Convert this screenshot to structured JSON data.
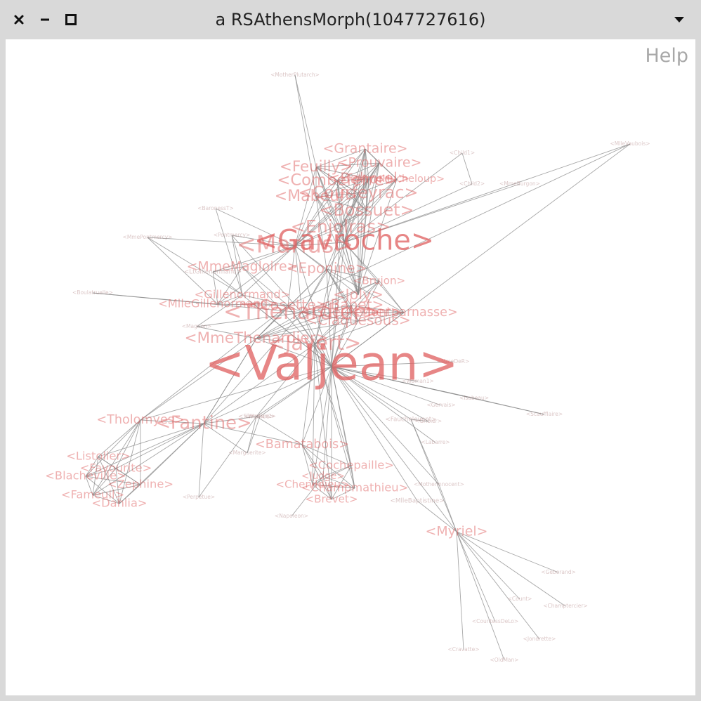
{
  "window": {
    "title": "a RSAthensMorph(1047727616)",
    "close_icon": "close-icon",
    "minimize_icon": "minimize-icon",
    "maximize_icon": "maximize-icon",
    "menu_icon": "dropdown-triangle-icon"
  },
  "canvas": {
    "help_label": "Help",
    "edge_color": "#8a8a8a",
    "label_color": "#e06464"
  },
  "graph": {
    "nodes": [
      {
        "id": "valjean",
        "label": "<Valjean>",
        "weight": 1.0
      },
      {
        "id": "gavroche",
        "label": "<Gavroche>",
        "weight": 0.55
      },
      {
        "id": "marius",
        "label": "<Marius>",
        "weight": 0.45
      },
      {
        "id": "javert",
        "label": "<Javert>",
        "weight": 0.38
      },
      {
        "id": "thenardier",
        "label": "<Thenardier>",
        "weight": 0.42
      },
      {
        "id": "fantine",
        "label": "<Fantine>",
        "weight": 0.33
      },
      {
        "id": "enjolras",
        "label": "<Enjolras>",
        "weight": 0.32
      },
      {
        "id": "courfeyrac",
        "label": "<Courfeyrac>",
        "weight": 0.3
      },
      {
        "id": "bossuet",
        "label": "<Bossuet>",
        "weight": 0.3
      },
      {
        "id": "combeferre",
        "label": "<Combeferre>",
        "weight": 0.28
      },
      {
        "id": "mabeuf",
        "label": "<Mabeuf>",
        "weight": 0.27
      },
      {
        "id": "feuilly",
        "label": "<Feuilly>",
        "weight": 0.26
      },
      {
        "id": "bahorel",
        "label": "<Bahorel>",
        "weight": 0.26
      },
      {
        "id": "joly",
        "label": "<Joly>",
        "weight": 0.25
      },
      {
        "id": "grantaire",
        "label": "<Grantaire>",
        "weight": 0.22
      },
      {
        "id": "prouvaire",
        "label": "<Prouvaire>",
        "weight": 0.22
      },
      {
        "id": "eponine",
        "label": "<Eponine>",
        "weight": 0.24
      },
      {
        "id": "mmethenardier",
        "label": "<MmeThenardier>",
        "weight": 0.26
      },
      {
        "id": "babet",
        "label": "<Babet>",
        "weight": 0.24
      },
      {
        "id": "gueulemer",
        "label": "<Gueulemer>",
        "weight": 0.24
      },
      {
        "id": "claquesous",
        "label": "<Claquesous>",
        "weight": 0.24
      },
      {
        "id": "montparnasse",
        "label": "<Montparnasse>",
        "weight": 0.2
      },
      {
        "id": "brujon",
        "label": "<Brujon>",
        "weight": 0.16
      },
      {
        "id": "cosette",
        "label": "<Cosette>",
        "weight": 0.25
      },
      {
        "id": "mmemagloire",
        "label": "<MmeMagloire>",
        "weight": 0.22
      },
      {
        "id": "gillenormand",
        "label": "<Gillenormand>",
        "weight": 0.18
      },
      {
        "id": "mllegillenormand",
        "label": "<MlleGillenormand>",
        "weight": 0.18
      },
      {
        "id": "tholomyes",
        "label": "<Tholomyes>",
        "weight": 0.2
      },
      {
        "id": "listolier",
        "label": "<Listolier>",
        "weight": 0.18
      },
      {
        "id": "fameuil",
        "label": "<Fameuil>",
        "weight": 0.18
      },
      {
        "id": "blacheville",
        "label": "<Blacheville>",
        "weight": 0.18
      },
      {
        "id": "favourite",
        "label": "<Favourite>",
        "weight": 0.18
      },
      {
        "id": "zephine",
        "label": "<Zephine>",
        "weight": 0.18
      },
      {
        "id": "dahlia",
        "label": "<Dahlia>",
        "weight": 0.18
      },
      {
        "id": "bamatabois",
        "label": "<Bamatabois>",
        "weight": 0.2
      },
      {
        "id": "champmathieu",
        "label": "<Champmathieu>",
        "weight": 0.18
      },
      {
        "id": "chenildieu",
        "label": "<Chenildieu>",
        "weight": 0.16
      },
      {
        "id": "cochepaille",
        "label": "<Cochepaille>",
        "weight": 0.18
      },
      {
        "id": "brevet",
        "label": "<Brevet>",
        "weight": 0.16
      },
      {
        "id": "judge",
        "label": "<Judge>",
        "weight": 0.14
      },
      {
        "id": "myriel",
        "label": "<Myriel>",
        "weight": 0.22
      },
      {
        "id": "child1",
        "label": "<Child1>",
        "weight": 0.04
      },
      {
        "id": "child2",
        "label": "<Child2>",
        "weight": 0.04
      },
      {
        "id": "magnon",
        "label": "<Magnon>",
        "weight": 0.04
      },
      {
        "id": "mmeburgon",
        "label": "<MmeBurgon>",
        "weight": 0.04
      },
      {
        "id": "mmehucheloup",
        "label": "<MmeHucheloup>",
        "weight": 0.15
      },
      {
        "id": "boulatruelle",
        "label": "<Boulatruelle>",
        "weight": 0.04
      },
      {
        "id": "motherplutarch",
        "label": "<MotherPlutarch>",
        "weight": 0.04
      },
      {
        "id": "baronesst",
        "label": "<BaronessT>",
        "weight": 0.04
      },
      {
        "id": "ltgillenormand",
        "label": "<LtGillenormand>",
        "weight": 0.06
      },
      {
        "id": "mmepontmercy",
        "label": "<MmePontmercy>",
        "weight": 0.04
      },
      {
        "id": "pontmercy",
        "label": "<Pontmercy>",
        "weight": 0.04
      },
      {
        "id": "mlleVaubois",
        "label": "<MlleVaubois>",
        "weight": 0.04
      },
      {
        "id": "toussaint",
        "label": "<Toussaint>",
        "weight": 0.05
      },
      {
        "id": "mmeder",
        "label": "<MmeDeR>",
        "weight": 0.04
      },
      {
        "id": "isabeau",
        "label": "<Isabeau>",
        "weight": 0.04
      },
      {
        "id": "gervais",
        "label": "<Gervais>",
        "weight": 0.04
      },
      {
        "id": "scaufflaire",
        "label": "<Scaufflaire>",
        "weight": 0.04
      },
      {
        "id": "woman1",
        "label": "<Woman1>",
        "weight": 0.04
      },
      {
        "id": "woman2",
        "label": "<Woman2>",
        "weight": 0.04
      },
      {
        "id": "labarre",
        "label": "<Labarre>",
        "weight": 0.04
      },
      {
        "id": "fauchelevent",
        "label": "<Fauchelevent>",
        "weight": 0.06
      },
      {
        "id": "gribier",
        "label": "<Gribier>",
        "weight": 0.04
      },
      {
        "id": "simplice",
        "label": "<Simplice>",
        "weight": 0.06
      },
      {
        "id": "perpetue",
        "label": "<Perpetue>",
        "weight": 0.04
      },
      {
        "id": "marguerite",
        "label": "<Marguerite>",
        "weight": 0.04
      },
      {
        "id": "motherinnocent",
        "label": "<MotherInnocent>",
        "weight": 0.04
      },
      {
        "id": "mllebaptistine",
        "label": "<MlleBaptistine>",
        "weight": 0.06
      },
      {
        "id": "napoleon",
        "label": "<Napoleon>",
        "weight": 0.04
      },
      {
        "id": "mllebaptistine2",
        "label": "<Count>",
        "weight": 0.04
      },
      {
        "id": "countessdelo",
        "label": "<CountessDeLo>",
        "weight": 0.04
      },
      {
        "id": "geborand",
        "label": "<Geborand>",
        "weight": 0.04
      },
      {
        "id": "champtercier",
        "label": "<Champtercier>",
        "weight": 0.04
      },
      {
        "id": "cravatte",
        "label": "<Cravatte>",
        "weight": 0.04
      },
      {
        "id": "oldman",
        "label": "<OldMan>",
        "weight": 0.04
      },
      {
        "id": "cochepaille2",
        "label": "<Jondrette>",
        "weight": 0.04
      }
    ]
  }
}
